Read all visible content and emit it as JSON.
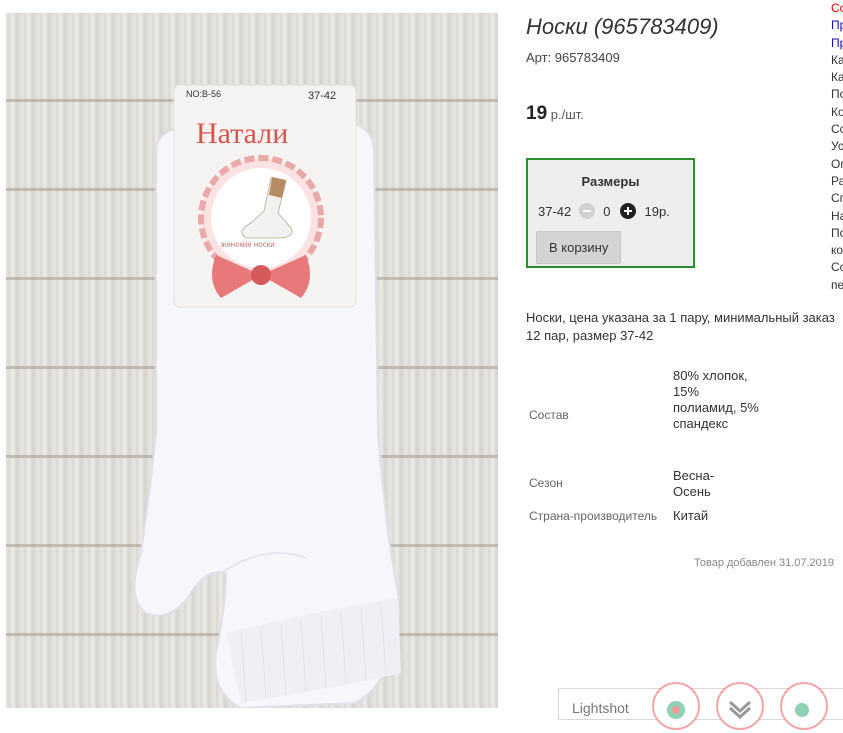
{
  "image": {
    "package_code": "NO:B-56",
    "package_size": "37-42",
    "brand": "Натали",
    "package_caption": "женские носки"
  },
  "product": {
    "title": "Носки (965783409)",
    "sku": "Арт: 965783409",
    "price_value": "19",
    "price_unit": "р./шт."
  },
  "sizes": {
    "title": "Размеры",
    "size": "37-42",
    "quantity": "0",
    "size_price": "19р.",
    "cart_button": "В корзину"
  },
  "description": "Носки, цена указана за 1 пару, минимальный заказ 12 пар, размер 37-42",
  "specs": [
    {
      "label": "Состав",
      "value": "80% хлопок, 15% полиамид, 5% спандекс"
    },
    {
      "label": "Сезон",
      "value": "Весна-Осень"
    },
    {
      "label": "Страна-производитель",
      "value": "Китай"
    }
  ],
  "added_date": "Товар добавлен 31.07.2019",
  "side_menu": {
    "items": [
      "Сс",
      "Пр",
      "Пр",
      "Ка",
      "Ка",
      "По",
      "Ко",
      "Сс",
      "Ус",
      "Оп",
      "Ра",
      "Сп",
      "На",
      "По",
      "ко",
      "Со",
      "пе"
    ],
    "colors": [
      "#cc0000",
      "#1a0dab",
      "#1a0dab",
      "#333333",
      "#333333",
      "#333333",
      "#333333",
      "#333333",
      "#333333",
      "#333333",
      "#333333",
      "#333333",
      "#333333",
      "#333333",
      "#333333",
      "#333333",
      "#333333"
    ]
  },
  "lightshot": {
    "label": "Lightshot"
  },
  "colors": {
    "sizes_border": "#2e8b2e",
    "brand_red": "#d9534f"
  }
}
